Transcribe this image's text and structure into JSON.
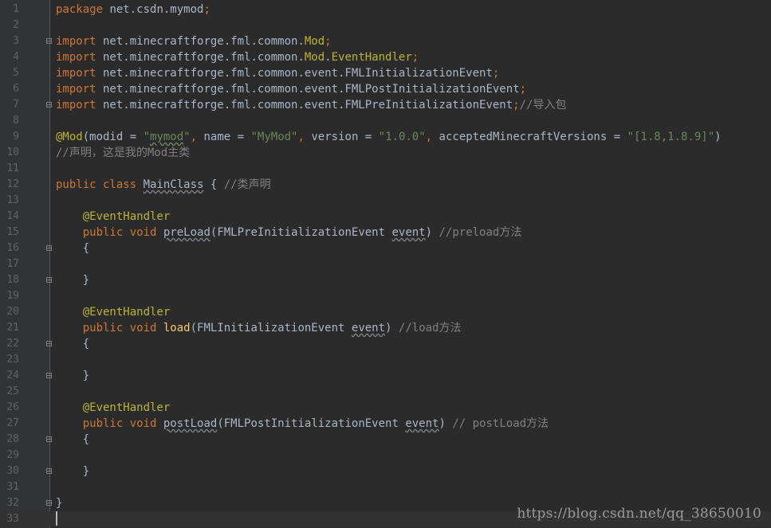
{
  "editor": {
    "lines": [
      {
        "n": "1",
        "parts": [
          [
            "kw",
            "package"
          ],
          [
            "pkg",
            " net.csdn.mymod"
          ],
          [
            "kw",
            ";"
          ]
        ]
      },
      {
        "n": "2",
        "parts": []
      },
      {
        "n": "3",
        "parts": [
          [
            "kw",
            "import"
          ],
          [
            "pkg",
            " net.minecraftforge.fml.common."
          ],
          [
            "ann",
            "Mod"
          ],
          [
            "kw",
            ";"
          ]
        ],
        "fold": true
      },
      {
        "n": "4",
        "parts": [
          [
            "kw",
            "import"
          ],
          [
            "pkg",
            " net.minecraftforge.fml.common."
          ],
          [
            "ann",
            "Mod"
          ],
          [
            "pkg",
            "."
          ],
          [
            "ann",
            "EventHandler"
          ],
          [
            "kw",
            ";"
          ]
        ]
      },
      {
        "n": "5",
        "parts": [
          [
            "kw",
            "import"
          ],
          [
            "pkg",
            " net.minecraftforge.fml.common.event.FMLInitializationEvent"
          ],
          [
            "kw",
            ";"
          ]
        ]
      },
      {
        "n": "6",
        "parts": [
          [
            "kw",
            "import"
          ],
          [
            "pkg",
            " net.minecraftforge.fml.common.event.FMLPostInitializationEvent"
          ],
          [
            "kw",
            ";"
          ]
        ]
      },
      {
        "n": "7",
        "parts": [
          [
            "kw",
            "import"
          ],
          [
            "pkg",
            " net.minecraftforge.fml.common.event.FMLPreInitializationEvent"
          ],
          [
            "kw",
            ";"
          ],
          [
            "cmt",
            "//导入包"
          ]
        ],
        "fold": true
      },
      {
        "n": "8",
        "parts": []
      },
      {
        "n": "9",
        "parts": [
          [
            "ann",
            "@Mod"
          ],
          [
            "pkg",
            "(modid = "
          ],
          [
            "str",
            "\""
          ],
          [
            "str ul",
            "mymod"
          ],
          [
            "str",
            "\""
          ],
          [
            "kw",
            ","
          ],
          [
            "pkg",
            " name = "
          ],
          [
            "str",
            "\"MyMod\""
          ],
          [
            "kw",
            ","
          ],
          [
            "pkg",
            " version = "
          ],
          [
            "str",
            "\"1.0.0\""
          ],
          [
            "kw",
            ","
          ],
          [
            "pkg",
            " acceptedMinecraftVersions = "
          ],
          [
            "str",
            "\"[1.8,1.8.9]\""
          ],
          [
            "pkg",
            ")"
          ]
        ]
      },
      {
        "n": "10",
        "parts": [
          [
            "cmt",
            "//声明，这是我的Mod主类"
          ]
        ]
      },
      {
        "n": "11",
        "parts": []
      },
      {
        "n": "12",
        "parts": [
          [
            "kw",
            "public class "
          ],
          [
            "cls ulg",
            "MainClass"
          ],
          [
            "pkg",
            " { "
          ],
          [
            "cmt",
            "//类声明"
          ]
        ]
      },
      {
        "n": "13",
        "parts": []
      },
      {
        "n": "14",
        "parts": [
          [
            "pkg",
            "    "
          ],
          [
            "ann",
            "@EventHandler"
          ]
        ]
      },
      {
        "n": "15",
        "parts": [
          [
            "pkg",
            "    "
          ],
          [
            "kw",
            "public void "
          ],
          [
            "cls ulg",
            "preLoad"
          ],
          [
            "pkg",
            "(FMLPreInitializationEvent "
          ],
          [
            "cls ulg",
            "event"
          ],
          [
            "pkg",
            ") "
          ],
          [
            "cmt",
            "//preload方法"
          ]
        ]
      },
      {
        "n": "16",
        "parts": [
          [
            "pkg",
            "    {"
          ]
        ],
        "fold": true
      },
      {
        "n": "17",
        "parts": []
      },
      {
        "n": "18",
        "parts": [
          [
            "pkg",
            "    }"
          ]
        ],
        "fold": true
      },
      {
        "n": "19",
        "parts": []
      },
      {
        "n": "20",
        "parts": [
          [
            "pkg",
            "    "
          ],
          [
            "ann",
            "@EventHandler"
          ]
        ]
      },
      {
        "n": "21",
        "parts": [
          [
            "pkg",
            "    "
          ],
          [
            "kw",
            "public void "
          ],
          [
            "fn",
            "load"
          ],
          [
            "pkg",
            "(FMLInitializationEvent "
          ],
          [
            "cls ulg",
            "event"
          ],
          [
            "pkg",
            ") "
          ],
          [
            "cmt",
            "//load方法"
          ]
        ]
      },
      {
        "n": "22",
        "parts": [
          [
            "pkg",
            "    {"
          ]
        ],
        "fold": true
      },
      {
        "n": "23",
        "parts": []
      },
      {
        "n": "24",
        "parts": [
          [
            "pkg",
            "    }"
          ]
        ],
        "fold": true
      },
      {
        "n": "25",
        "parts": []
      },
      {
        "n": "26",
        "parts": [
          [
            "pkg",
            "    "
          ],
          [
            "ann",
            "@EventHandler"
          ]
        ]
      },
      {
        "n": "27",
        "parts": [
          [
            "pkg",
            "    "
          ],
          [
            "kw",
            "public void "
          ],
          [
            "cls ulg",
            "postLoad"
          ],
          [
            "pkg",
            "(FMLPostInitializationEvent "
          ],
          [
            "cls ulg",
            "event"
          ],
          [
            "pkg",
            ") "
          ],
          [
            "cmt",
            "// postLoad方法"
          ]
        ]
      },
      {
        "n": "28",
        "parts": [
          [
            "pkg",
            "    {"
          ]
        ],
        "fold": true
      },
      {
        "n": "29",
        "parts": []
      },
      {
        "n": "30",
        "parts": [
          [
            "pkg",
            "    }"
          ]
        ],
        "fold": true
      },
      {
        "n": "31",
        "parts": []
      },
      {
        "n": "32",
        "parts": [
          [
            "pkg",
            "}"
          ]
        ],
        "fold": true
      },
      {
        "n": "33",
        "parts": [],
        "current": true
      }
    ]
  },
  "watermark": {
    "text": "https://blog.csdn.net/qq_38650010"
  },
  "colors": {
    "background": "#2b2b2b",
    "gutter": "#313335",
    "keyword": "#cc7832",
    "annotation": "#bbb529",
    "string": "#6a8759",
    "comment": "#808080",
    "text": "#a9b7c6",
    "method": "#ffc66d"
  }
}
